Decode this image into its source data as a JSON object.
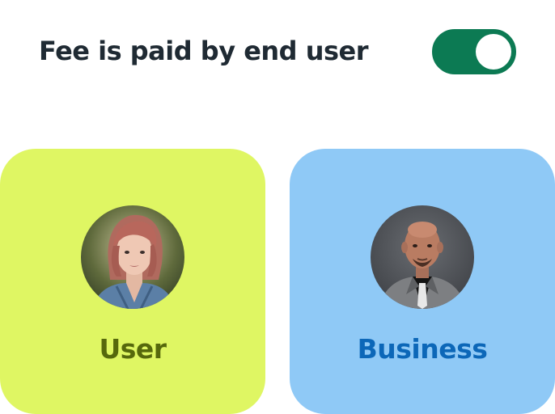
{
  "settings": {
    "fee_label": "Fee is paid by end user",
    "fee_toggle_on": true
  },
  "cards": [
    {
      "label": "User"
    },
    {
      "label": "Business"
    }
  ],
  "colors": {
    "toggle_on": "#0c7a53",
    "user_card": "#dff663",
    "user_text": "#56680c",
    "business_card": "#8fc9f6",
    "business_text": "#0c67b8",
    "title_text": "#1f2a33"
  }
}
